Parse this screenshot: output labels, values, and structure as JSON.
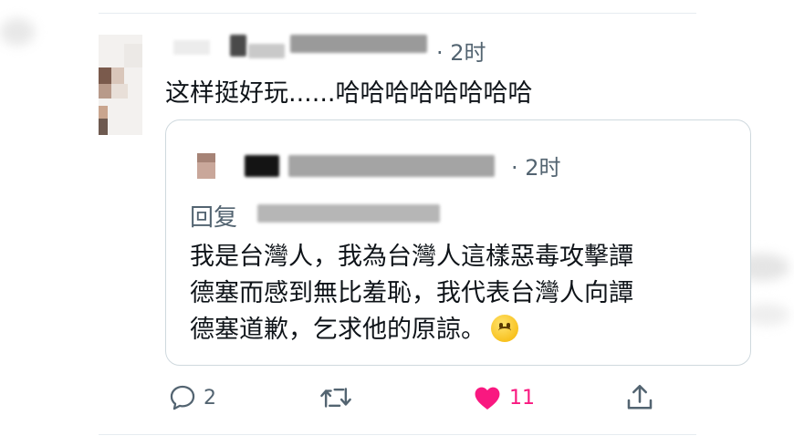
{
  "tweet": {
    "time": "· 2时",
    "text": "这样挺好玩......哈哈哈哈哈哈哈哈"
  },
  "quote": {
    "time": "· 2时",
    "reply_label": "回复",
    "lines": [
      "我是台灣人，我為台灣人這樣惡毒攻擊譚",
      "德塞而感到無比羞恥，我代表台灣人向譚",
      "德塞道歉，乞求他的原諒。"
    ],
    "emoji": "upside-down-face"
  },
  "actions": {
    "reply_count": "2",
    "retweet_count": "",
    "like_count": "11",
    "like_color": "#f91880"
  }
}
